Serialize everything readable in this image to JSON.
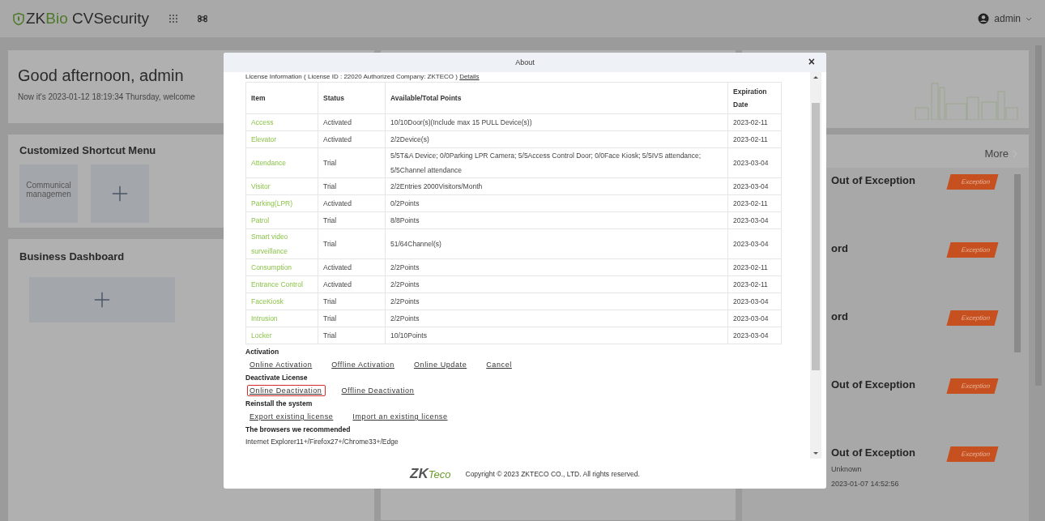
{
  "header": {
    "logo_prefix": "ZK",
    "logo_suffix": "Bio",
    "product": "CVSecurity",
    "user": "admin"
  },
  "greeting": {
    "title": "Good afternoon, admin",
    "subtitle": "Now it's 2023-01-12 18:19:34 Thursday, welcome"
  },
  "shortcut_menu": {
    "title": "Customized Shortcut Menu",
    "tiles": [
      {
        "kind": "app",
        "line1": "Communical",
        "line2": "managemen"
      },
      {
        "kind": "add"
      }
    ]
  },
  "business_dashboard": {
    "title": "Business Dashboard"
  },
  "events": {
    "more": "More",
    "items": [
      {
        "title": "Out of Exception",
        "badge": "Exception"
      },
      {
        "title": "ord",
        "badge": "Exception"
      },
      {
        "title": "ord",
        "badge": "Exception"
      },
      {
        "title": "Out of Exception",
        "badge": "Exception"
      },
      {
        "title": "Out of Exception",
        "badge": "Exception",
        "source": "Unknown",
        "time": "2023-01-07 14:52:56"
      }
    ]
  },
  "about_dialog": {
    "title": "About",
    "close": "×",
    "license_line": "License Information ( License ID : 22020   Authorized Company: ZKTECO )",
    "details_link": "Details",
    "columns": [
      "Item",
      "Status",
      "Available/Total Points",
      "Expiration Date"
    ],
    "rows": [
      {
        "item": "Access",
        "status": "Activated",
        "points": "10/10Door(s)(Include max 15 PULL Device(s))",
        "expiration": "2023-02-11"
      },
      {
        "item": "Elevator",
        "status": "Activated",
        "points": "2/2Device(s)",
        "expiration": "2023-02-11"
      },
      {
        "item": "Attendance",
        "status": "Trial",
        "points": "5/5T&A Device; 0/0Parking LPR Camera; 5/5Access Control Door; 0/0Face Kiosk; 5/5IVS attendance; 5/5Channel attendance",
        "expiration": "2023-03-04"
      },
      {
        "item": "Visitor",
        "status": "Trial",
        "points": "2/2Entries 2000Visitors/Month",
        "expiration": "2023-03-04"
      },
      {
        "item": "Parking(LPR)",
        "status": "Activated",
        "points": "0/2Points",
        "expiration": "2023-02-11"
      },
      {
        "item": "Patrol",
        "status": "Trial",
        "points": "8/8Points",
        "expiration": "2023-03-04"
      },
      {
        "item": "Smart video surveillance",
        "status": "Trial",
        "points": "51/64Channel(s)",
        "expiration": "2023-03-04"
      },
      {
        "item": "Consumption",
        "status": "Activated",
        "points": "2/2Points",
        "expiration": "2023-02-11"
      },
      {
        "item": "Entrance Control",
        "status": "Activated",
        "points": "2/2Points",
        "expiration": "2023-02-11"
      },
      {
        "item": "FaceKiosk",
        "status": "Trial",
        "points": "2/2Points",
        "expiration": "2023-03-04"
      },
      {
        "item": "Intrusion",
        "status": "Trial",
        "points": "2/2Points",
        "expiration": "2023-03-04"
      },
      {
        "item": "Locker",
        "status": "Trial",
        "points": "10/10Points",
        "expiration": "2023-03-04"
      }
    ],
    "sections": [
      {
        "heading": "Activation",
        "links": [
          {
            "label": "Online Activation",
            "highlighted": false
          },
          {
            "label": "Offline Activation",
            "highlighted": false
          },
          {
            "label": "Online Update",
            "highlighted": false
          },
          {
            "label": "Cancel",
            "highlighted": false
          }
        ]
      },
      {
        "heading": "Deactivate License",
        "links": [
          {
            "label": "Online Deactivation",
            "highlighted": true
          },
          {
            "label": "Offline Deactivation",
            "highlighted": false
          }
        ]
      },
      {
        "heading": "Reinstall the system",
        "links": [
          {
            "label": "Export existing license",
            "highlighted": false
          },
          {
            "label": "Import an existing license",
            "highlighted": false
          }
        ]
      },
      {
        "heading": "The browsers we recommended",
        "text": "Internet Explorer11+/Firefox27+/Chrome33+/Edge"
      }
    ],
    "footer": {
      "logo_bold": "ZK",
      "logo_light": "Teco",
      "copyright": "Copyright © 2023 ZKTECO CO., LTD. All rights reserved."
    }
  }
}
